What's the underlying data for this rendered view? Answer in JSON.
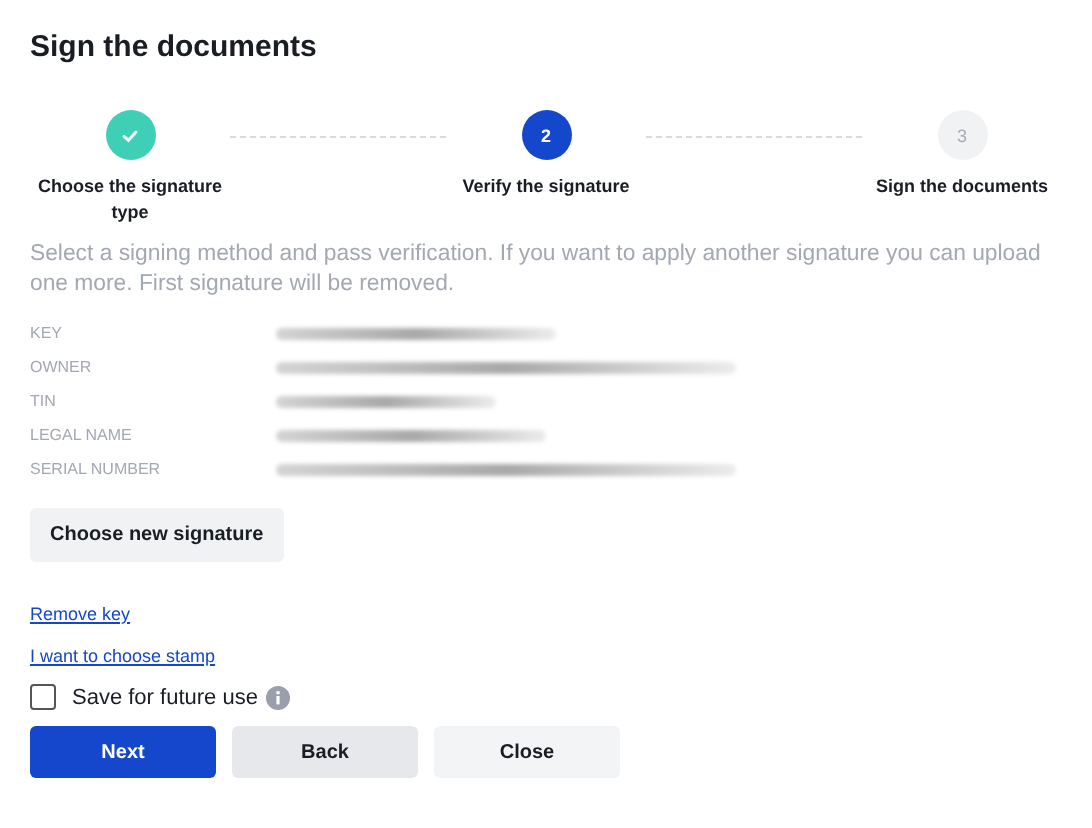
{
  "title": "Sign the documents",
  "steps": [
    {
      "label": "Choose the signature type",
      "kind": "done"
    },
    {
      "label": "Verify the signature",
      "kind": "current",
      "number": "2"
    },
    {
      "label": "Sign the documents",
      "kind": "upcoming",
      "number": "3"
    }
  ],
  "description": "Select a signing method and pass verification. If you want to apply another signature you can upload one more. First signature will be removed.",
  "fields": [
    {
      "label": "KEY"
    },
    {
      "label": "OWNER"
    },
    {
      "label": "TIN"
    },
    {
      "label": "LEGAL NAME"
    },
    {
      "label": "SERIAL NUMBER"
    }
  ],
  "choose_button": "Choose new signature",
  "links": [
    "Remove key",
    "I want to choose stamp"
  ],
  "save_option": {
    "label": "Save for future use",
    "checked": false
  },
  "buttons": [
    {
      "label": "Next",
      "kind": "primary"
    },
    {
      "label": "Back",
      "kind": "secondary"
    },
    {
      "label": "Close",
      "kind": "tertiary"
    }
  ]
}
